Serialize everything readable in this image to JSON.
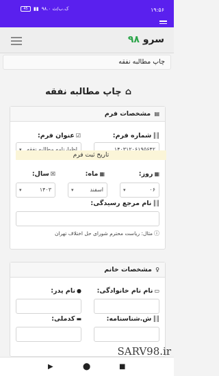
{
  "status_bar": {
    "time": "۱۹:۵۶",
    "speed": "۹۸.۰ ک.ب/ث",
    "battery": "45"
  },
  "app": {
    "brand_text": "سرو",
    "brand_number": "۹۸"
  },
  "breadcrumb": "چاپ مطالبه نفقه",
  "page_title": "چاپ مطالبه نفقه",
  "form_card": {
    "header": "مشخصات فرم",
    "form_number_label": "شماره فرم:",
    "form_number_value": "۱۴۰۳۱۲۰۶۱۹۵۶۴۲",
    "form_title_label": "عنوان فرم:",
    "form_title_value": "اظهارنامه مطالبه نفقه",
    "notice": "تاریخ ثبت فرم",
    "day_label": "روز:",
    "day_value": "۰۶",
    "month_label": "ماه:",
    "month_value": "اسفند",
    "year_label": "سال:",
    "year_value": "۱۴۰۳",
    "ref_label": "نام مرجع رسیدگی:",
    "ref_value": "",
    "example": "مثال: ریاست محترم شورای حل اختلاف تهران"
  },
  "wife_card": {
    "header": "مشخصات خانم",
    "lastname_label": "نام نام خانوادگی:",
    "father_label": "نام پدر:",
    "id_label": "ش.شناسنامه:",
    "national_label": "کدملی:"
  },
  "watermark": "SARV98.ir",
  "colors": {
    "status_bar": "#5a20ee",
    "brand_accent": "#2ca54a",
    "notice_bg": "#fbf5d8"
  }
}
